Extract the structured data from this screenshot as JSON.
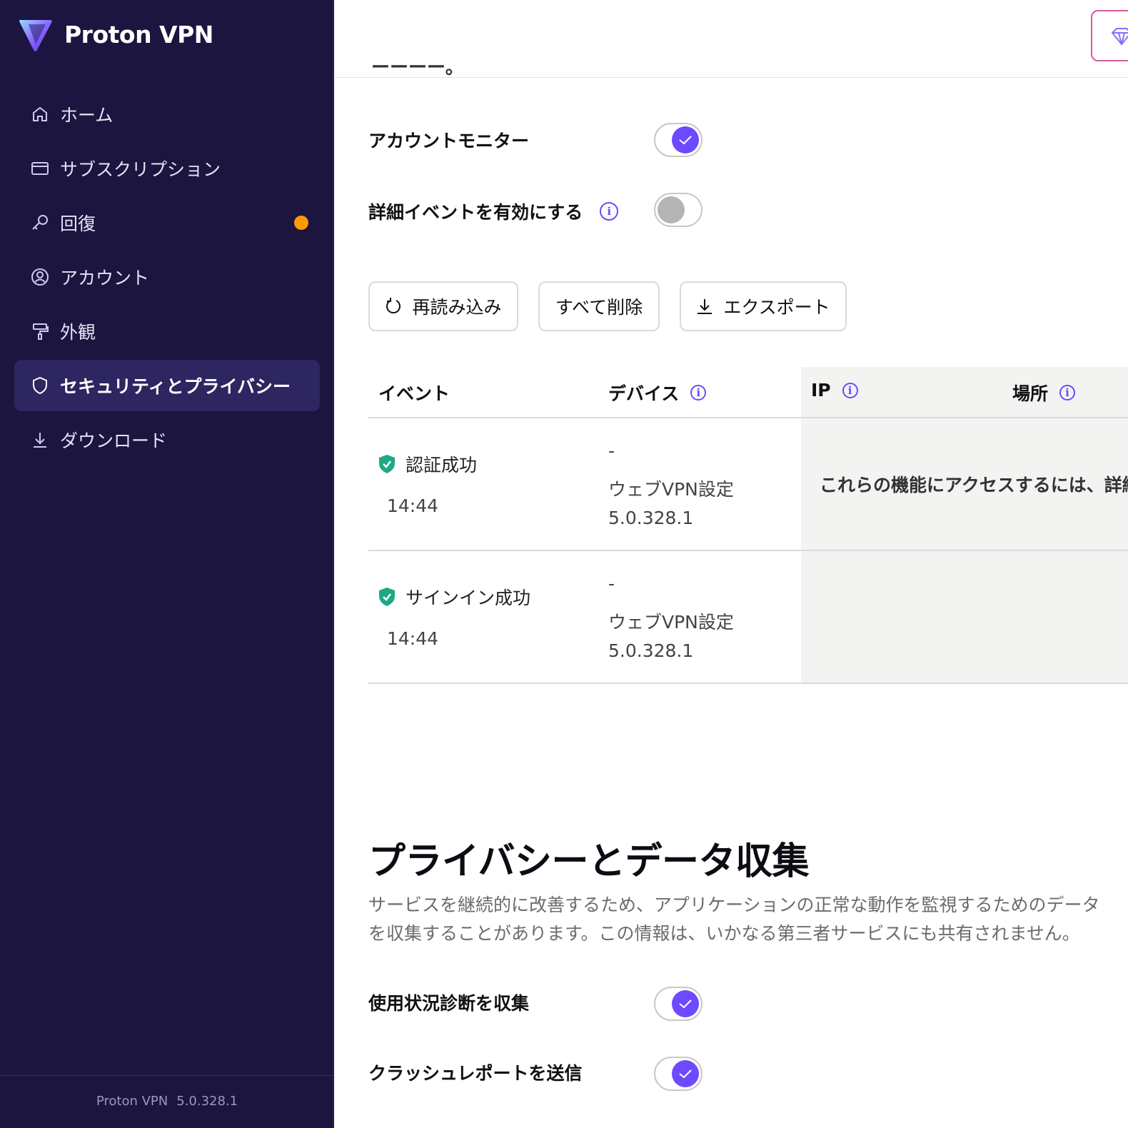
{
  "app": {
    "brand": "Proton VPN",
    "footer_name": "Proton VPN",
    "footer_version": "5.0.328.1"
  },
  "sidebar": {
    "items": [
      {
        "label": "ホーム",
        "icon": "home-icon"
      },
      {
        "label": "サブスクリプション",
        "icon": "credit-card-icon"
      },
      {
        "label": "回復",
        "icon": "key-icon",
        "badge": "orange-dot"
      },
      {
        "label": "アカウント",
        "icon": "user-circle-icon"
      },
      {
        "label": "外観",
        "icon": "paint-roller-icon"
      },
      {
        "label": "セキュリティとプライバシー",
        "icon": "shield-icon",
        "active": true
      },
      {
        "label": "ダウンロード",
        "icon": "download-icon"
      }
    ]
  },
  "header": {
    "upgrade_icon": "diamond-icon",
    "cut_off_text": "ーーーー。"
  },
  "security_logs": {
    "account_monitor_label": "アカウントモニター",
    "account_monitor_on": true,
    "advanced_events_label": "詳細イベントを有効にする",
    "advanced_events_on": false,
    "buttons": {
      "reload": "再読み込み",
      "delete_all": "すべて削除",
      "export": "エクスポート"
    },
    "columns": {
      "event": "イベント",
      "device": "デバイス",
      "ip": "IP",
      "location": "場所"
    },
    "rows": [
      {
        "event": "認証成功",
        "time": "14:44",
        "device_dash": "-",
        "device_app": "ウェブVPN設定",
        "device_version": "5.0.328.1"
      },
      {
        "event": "サインイン成功",
        "time": "14:44",
        "device_dash": "-",
        "device_app": "ウェブVPN設定",
        "device_version": "5.0.328.1"
      }
    ],
    "gated_message": "これらの機能にアクセスするには、詳細イ"
  },
  "privacy": {
    "title": "プライバシーとデータ収集",
    "description": "サービスを継続的に改善するため、アプリケーションの正常な動作を監視するためのデータを収集することがあります。この情報は、いかなる第三者サービスにも共有されません。",
    "usage_diagnostics_label": "使用状況診断を収集",
    "usage_diagnostics_on": true,
    "crash_reports_label": "クラッシュレポートを送信",
    "crash_reports_on": true
  },
  "colors": {
    "sidebar_bg": "#1b1540",
    "accent": "#6d4aff",
    "badge": "#ff9900",
    "success": "#1ea885"
  }
}
